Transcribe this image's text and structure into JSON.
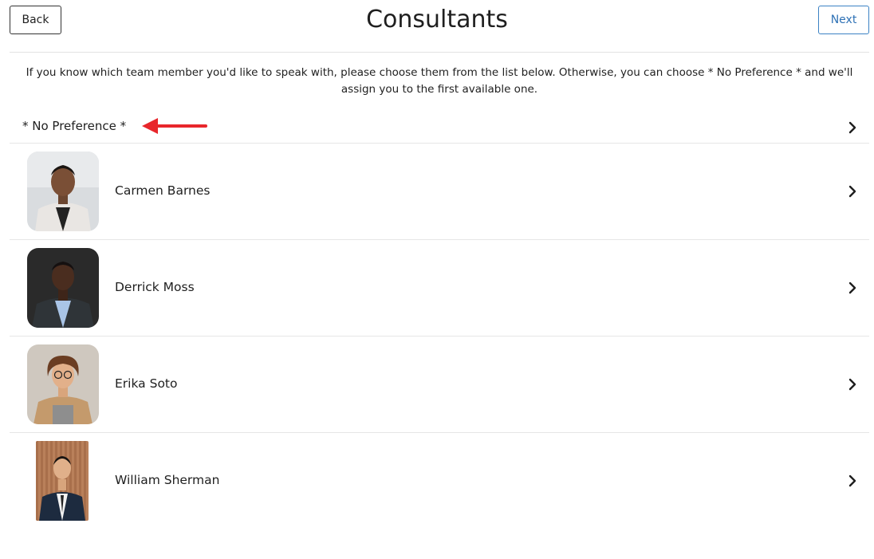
{
  "header": {
    "back_label": "Back",
    "title": "Consultants",
    "next_label": "Next"
  },
  "intro_text": "If you know which team member you'd like to speak with, please choose them from the list below. Otherwise, you can choose * No Preference * and we'll assign you to the first available one.",
  "no_preference": {
    "label": "* No Preference *",
    "annotation_color": "#e8262b"
  },
  "consultants": [
    {
      "name": "Carmen Barnes"
    },
    {
      "name": "Derrick Moss"
    },
    {
      "name": "Erika Soto"
    },
    {
      "name": "William Sherman"
    }
  ],
  "colors": {
    "accent": "#2f72b6",
    "text": "#1f1f1f",
    "divider": "#e6e6e6"
  }
}
